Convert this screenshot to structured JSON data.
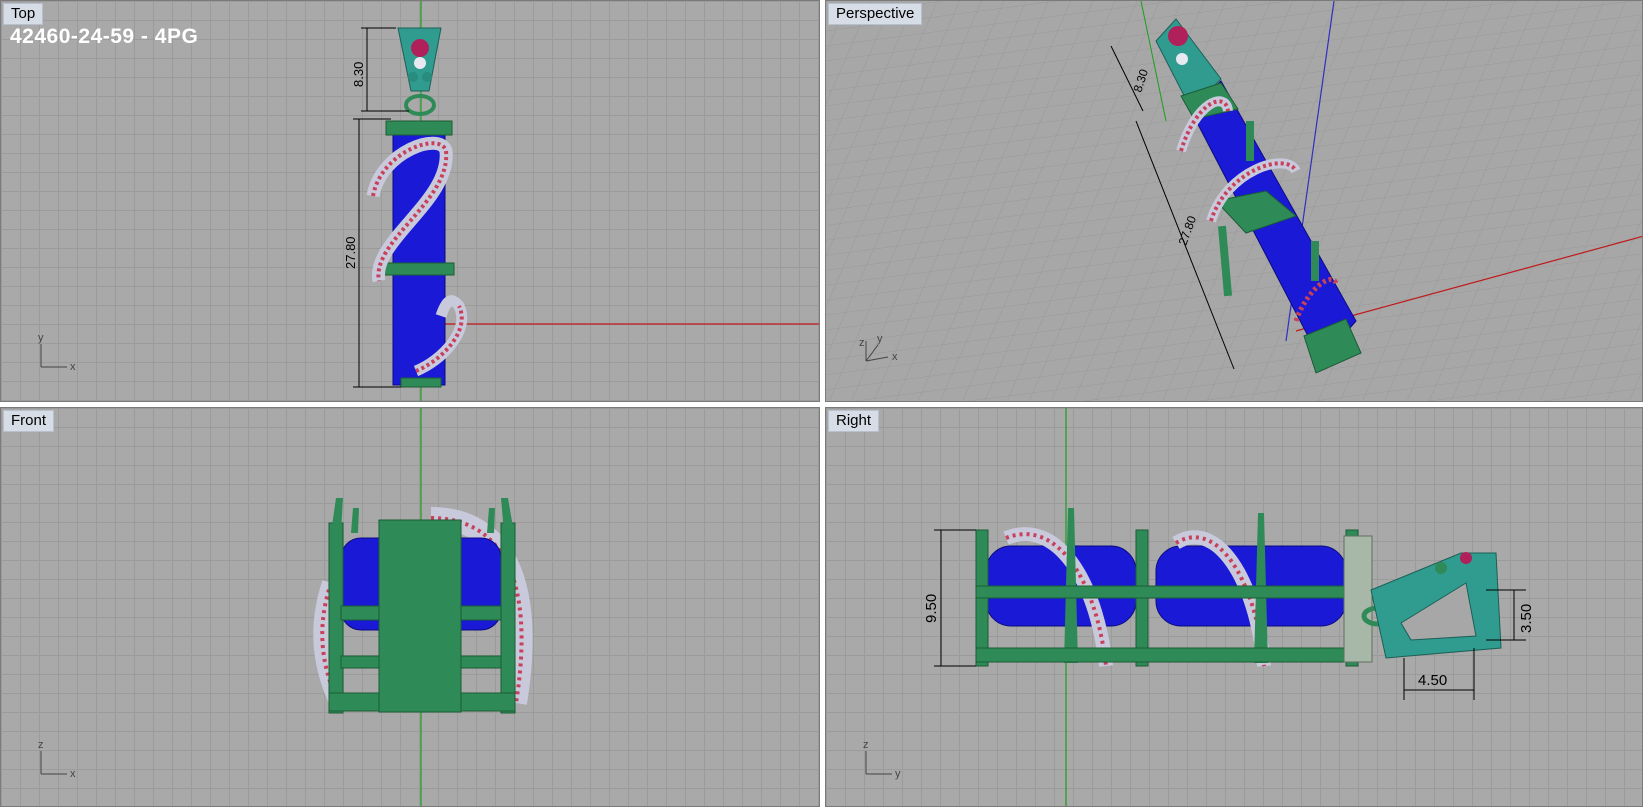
{
  "viewports": {
    "top": {
      "label": "Top"
    },
    "perspective": {
      "label": "Perspective"
    },
    "front": {
      "label": "Front"
    },
    "right": {
      "label": "Right"
    }
  },
  "model_title": "42460-24-59 - 4PG",
  "dimensions": {
    "bail_height": "8.30",
    "body_length": "27.80",
    "persp_bail": "8.30",
    "persp_body": "27.80",
    "height": "9.50",
    "bail_depth": "3.50",
    "bail_width": "4.50"
  },
  "axes": {
    "top": {
      "v": "y",
      "h": "x"
    },
    "persp": {
      "v": "z",
      "h": "x",
      "d": "y"
    },
    "front": {
      "v": "z",
      "h": "x"
    },
    "right": {
      "v": "z",
      "h": "y"
    }
  },
  "colors": {
    "metal": "#2e8b57",
    "gem": "#1a1ad6",
    "ruby": "#c8405a",
    "silver": "#c9c9dc",
    "teal": "#2f9c8f"
  }
}
